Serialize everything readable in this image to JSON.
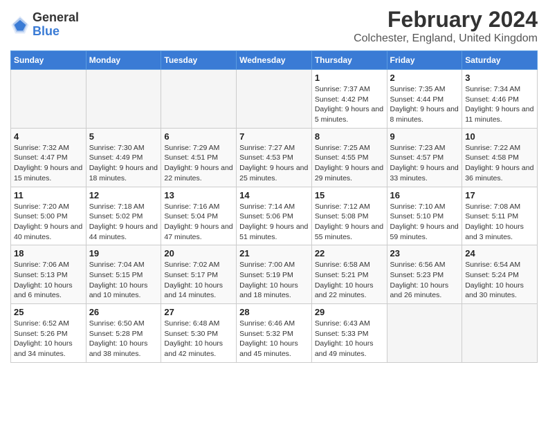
{
  "header": {
    "logo_general": "General",
    "logo_blue": "Blue",
    "title": "February 2024",
    "subtitle": "Colchester, England, United Kingdom"
  },
  "calendar": {
    "days_of_week": [
      "Sunday",
      "Monday",
      "Tuesday",
      "Wednesday",
      "Thursday",
      "Friday",
      "Saturday"
    ],
    "weeks": [
      [
        {
          "day": "",
          "info": ""
        },
        {
          "day": "",
          "info": ""
        },
        {
          "day": "",
          "info": ""
        },
        {
          "day": "",
          "info": ""
        },
        {
          "day": "1",
          "info": "Sunrise: 7:37 AM\nSunset: 4:42 PM\nDaylight: 9 hours and 5 minutes."
        },
        {
          "day": "2",
          "info": "Sunrise: 7:35 AM\nSunset: 4:44 PM\nDaylight: 9 hours and 8 minutes."
        },
        {
          "day": "3",
          "info": "Sunrise: 7:34 AM\nSunset: 4:46 PM\nDaylight: 9 hours and 11 minutes."
        }
      ],
      [
        {
          "day": "4",
          "info": "Sunrise: 7:32 AM\nSunset: 4:47 PM\nDaylight: 9 hours and 15 minutes."
        },
        {
          "day": "5",
          "info": "Sunrise: 7:30 AM\nSunset: 4:49 PM\nDaylight: 9 hours and 18 minutes."
        },
        {
          "day": "6",
          "info": "Sunrise: 7:29 AM\nSunset: 4:51 PM\nDaylight: 9 hours and 22 minutes."
        },
        {
          "day": "7",
          "info": "Sunrise: 7:27 AM\nSunset: 4:53 PM\nDaylight: 9 hours and 25 minutes."
        },
        {
          "day": "8",
          "info": "Sunrise: 7:25 AM\nSunset: 4:55 PM\nDaylight: 9 hours and 29 minutes."
        },
        {
          "day": "9",
          "info": "Sunrise: 7:23 AM\nSunset: 4:57 PM\nDaylight: 9 hours and 33 minutes."
        },
        {
          "day": "10",
          "info": "Sunrise: 7:22 AM\nSunset: 4:58 PM\nDaylight: 9 hours and 36 minutes."
        }
      ],
      [
        {
          "day": "11",
          "info": "Sunrise: 7:20 AM\nSunset: 5:00 PM\nDaylight: 9 hours and 40 minutes."
        },
        {
          "day": "12",
          "info": "Sunrise: 7:18 AM\nSunset: 5:02 PM\nDaylight: 9 hours and 44 minutes."
        },
        {
          "day": "13",
          "info": "Sunrise: 7:16 AM\nSunset: 5:04 PM\nDaylight: 9 hours and 47 minutes."
        },
        {
          "day": "14",
          "info": "Sunrise: 7:14 AM\nSunset: 5:06 PM\nDaylight: 9 hours and 51 minutes."
        },
        {
          "day": "15",
          "info": "Sunrise: 7:12 AM\nSunset: 5:08 PM\nDaylight: 9 hours and 55 minutes."
        },
        {
          "day": "16",
          "info": "Sunrise: 7:10 AM\nSunset: 5:10 PM\nDaylight: 9 hours and 59 minutes."
        },
        {
          "day": "17",
          "info": "Sunrise: 7:08 AM\nSunset: 5:11 PM\nDaylight: 10 hours and 3 minutes."
        }
      ],
      [
        {
          "day": "18",
          "info": "Sunrise: 7:06 AM\nSunset: 5:13 PM\nDaylight: 10 hours and 6 minutes."
        },
        {
          "day": "19",
          "info": "Sunrise: 7:04 AM\nSunset: 5:15 PM\nDaylight: 10 hours and 10 minutes."
        },
        {
          "day": "20",
          "info": "Sunrise: 7:02 AM\nSunset: 5:17 PM\nDaylight: 10 hours and 14 minutes."
        },
        {
          "day": "21",
          "info": "Sunrise: 7:00 AM\nSunset: 5:19 PM\nDaylight: 10 hours and 18 minutes."
        },
        {
          "day": "22",
          "info": "Sunrise: 6:58 AM\nSunset: 5:21 PM\nDaylight: 10 hours and 22 minutes."
        },
        {
          "day": "23",
          "info": "Sunrise: 6:56 AM\nSunset: 5:23 PM\nDaylight: 10 hours and 26 minutes."
        },
        {
          "day": "24",
          "info": "Sunrise: 6:54 AM\nSunset: 5:24 PM\nDaylight: 10 hours and 30 minutes."
        }
      ],
      [
        {
          "day": "25",
          "info": "Sunrise: 6:52 AM\nSunset: 5:26 PM\nDaylight: 10 hours and 34 minutes."
        },
        {
          "day": "26",
          "info": "Sunrise: 6:50 AM\nSunset: 5:28 PM\nDaylight: 10 hours and 38 minutes."
        },
        {
          "day": "27",
          "info": "Sunrise: 6:48 AM\nSunset: 5:30 PM\nDaylight: 10 hours and 42 minutes."
        },
        {
          "day": "28",
          "info": "Sunrise: 6:46 AM\nSunset: 5:32 PM\nDaylight: 10 hours and 45 minutes."
        },
        {
          "day": "29",
          "info": "Sunrise: 6:43 AM\nSunset: 5:33 PM\nDaylight: 10 hours and 49 minutes."
        },
        {
          "day": "",
          "info": ""
        },
        {
          "day": "",
          "info": ""
        }
      ]
    ]
  }
}
